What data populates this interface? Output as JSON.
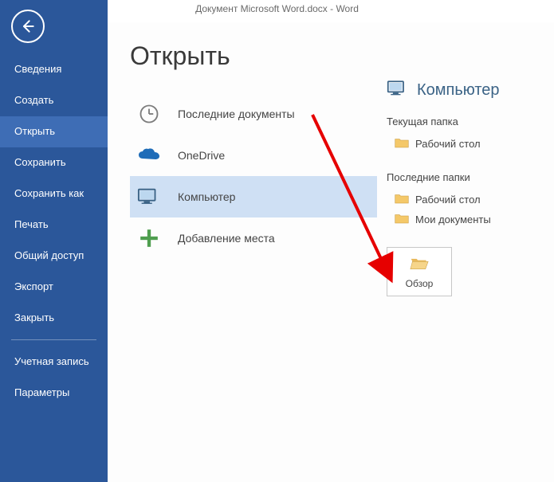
{
  "window_title": "Документ Microsoft Word.docx - Word",
  "sidebar": {
    "items": [
      {
        "label": "Сведения"
      },
      {
        "label": "Создать"
      },
      {
        "label": "Открыть",
        "selected": true
      },
      {
        "label": "Сохранить"
      },
      {
        "label": "Сохранить как"
      },
      {
        "label": "Печать"
      },
      {
        "label": "Общий доступ"
      },
      {
        "label": "Экспорт"
      },
      {
        "label": "Закрыть"
      }
    ],
    "footer_items": [
      {
        "label": "Учетная запись"
      },
      {
        "label": "Параметры"
      }
    ]
  },
  "page": {
    "title": "Открыть",
    "locations": [
      {
        "label": "Последние документы",
        "icon": "clock-icon"
      },
      {
        "label": "OneDrive",
        "icon": "onedrive-icon"
      },
      {
        "label": "Компьютер",
        "icon": "computer-icon",
        "selected": true
      },
      {
        "label": "Добавление места",
        "icon": "plus-icon"
      }
    ]
  },
  "right": {
    "title": "Компьютер",
    "current_folder": {
      "heading": "Текущая папка",
      "name": "Рабочий стол"
    },
    "recent_folders": {
      "heading": "Последние папки",
      "items": [
        "Рабочий стол",
        "Мои документы"
      ]
    },
    "browse_label": "Обзор"
  }
}
